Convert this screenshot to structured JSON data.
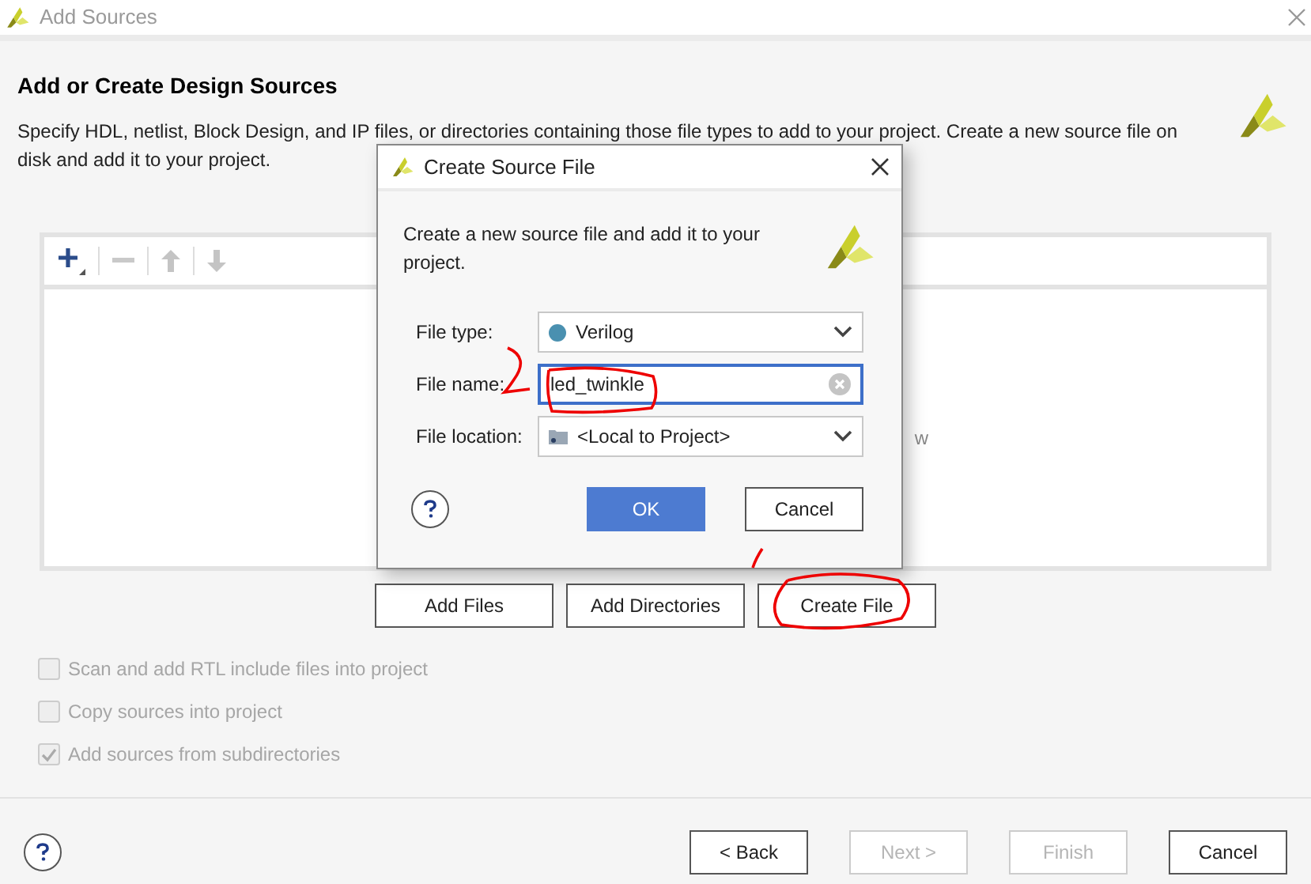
{
  "window": {
    "title": "Add Sources"
  },
  "page": {
    "heading": "Add or Create Design Sources",
    "description_lines": [
      "Specify HDL, netlist, Block Design, and IP files, or directories containing those file types to add to your project. Create a new source file on",
      "disk and add it to your project."
    ]
  },
  "list": {
    "hint_fragment": "w"
  },
  "list_buttons": [
    {
      "label": "Add Files"
    },
    {
      "label": "Add Directories"
    },
    {
      "label": "Create File"
    }
  ],
  "options": [
    {
      "label": "Scan and add RTL include files into project",
      "checked": false,
      "disabled": true
    },
    {
      "label": "Copy sources into project",
      "checked": false,
      "disabled": true
    },
    {
      "label": "Add sources from subdirectories",
      "checked": true,
      "disabled": true
    }
  ],
  "footer_buttons": [
    {
      "label": "< Back",
      "disabled": false
    },
    {
      "label": "Next >",
      "disabled": true
    },
    {
      "label": "Finish",
      "disabled": true
    },
    {
      "label": "Cancel",
      "disabled": false
    }
  ],
  "dialog": {
    "title": "Create Source File",
    "description": "Create a new source file and add it to your project.",
    "fields": [
      {
        "kind": "type_select",
        "label": "File type:",
        "value": "Verilog"
      },
      {
        "kind": "text",
        "label": "File name:",
        "value": "led_twinkle",
        "focused": true
      },
      {
        "kind": "location_select",
        "label": "File location:",
        "value": "<Local to Project>"
      }
    ],
    "buttons": [
      {
        "label": "OK",
        "primary": true
      },
      {
        "label": "Cancel",
        "primary": false
      }
    ]
  }
}
